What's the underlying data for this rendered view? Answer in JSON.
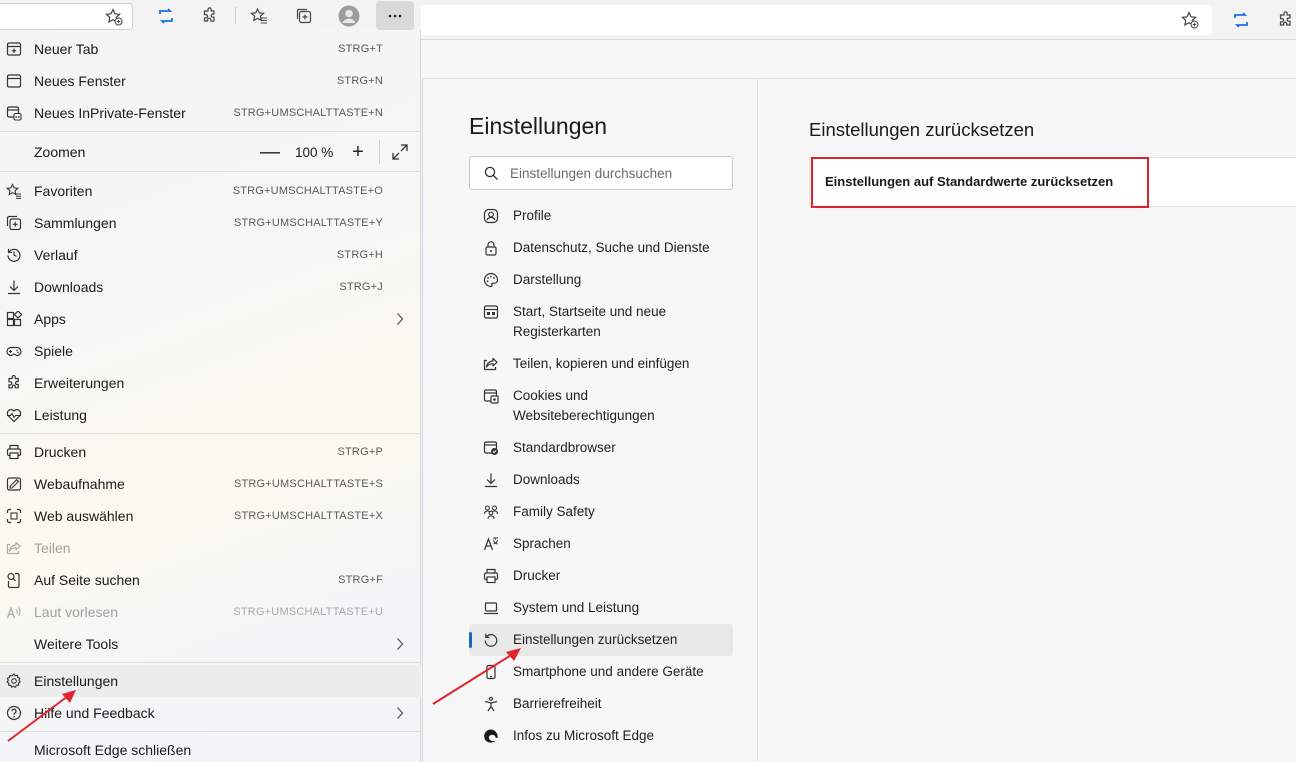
{
  "menu": {
    "items": [
      {
        "label": "Neuer Tab",
        "shortcut": "STRG+T",
        "icon": "new-tab-icon"
      },
      {
        "label": "Neues Fenster",
        "shortcut": "STRG+N",
        "icon": "new-window-icon"
      },
      {
        "label": "Neues InPrivate-Fenster",
        "shortcut": "STRG+UMSCHALTTASTE+N",
        "icon": "inprivate-icon"
      },
      {
        "label": "Zoomen",
        "icon": ""
      },
      {
        "label": "Favoriten",
        "shortcut": "STRG+UMSCHALTTASTE+O",
        "icon": "favorites-icon"
      },
      {
        "label": "Sammlungen",
        "shortcut": "STRG+UMSCHALTTASTE+Y",
        "icon": "collections-icon"
      },
      {
        "label": "Verlauf",
        "shortcut": "STRG+H",
        "icon": "history-icon"
      },
      {
        "label": "Downloads",
        "shortcut": "STRG+J",
        "icon": "download-icon"
      },
      {
        "label": "Apps",
        "icon": "apps-icon"
      },
      {
        "label": "Spiele",
        "icon": "games-icon"
      },
      {
        "label": "Erweiterungen",
        "icon": "extensions-icon"
      },
      {
        "label": "Leistung",
        "icon": "performance-icon"
      },
      {
        "label": "Drucken",
        "shortcut": "STRG+P",
        "icon": "print-icon"
      },
      {
        "label": "Webaufnahme",
        "shortcut": "STRG+UMSCHALTTASTE+S",
        "icon": "web-capture-icon"
      },
      {
        "label": "Web auswählen",
        "shortcut": "STRG+UMSCHALTTASTE+X",
        "icon": "web-select-icon"
      },
      {
        "label": "Teilen",
        "icon": "share-icon"
      },
      {
        "label": "Auf Seite suchen",
        "shortcut": "STRG+F",
        "icon": "find-icon"
      },
      {
        "label": "Laut vorlesen",
        "shortcut": "STRG+UMSCHALTTASTE+U",
        "icon": "read-aloud-icon"
      },
      {
        "label": "Weitere Tools",
        "icon": ""
      },
      {
        "label": "Einstellungen",
        "icon": "gear-icon"
      },
      {
        "label": "Hilfe und Feedback",
        "icon": "help-icon"
      },
      {
        "label": "Microsoft Edge schließen",
        "icon": ""
      }
    ],
    "zoom": {
      "minus": "—",
      "value": "100 %",
      "plus": "+"
    }
  },
  "settings": {
    "title": "Einstellungen",
    "search_placeholder": "Einstellungen durchsuchen",
    "nav": [
      {
        "label": "Profile",
        "icon": "profile-icon"
      },
      {
        "label": "Datenschutz, Suche und Dienste",
        "icon": "lock-icon"
      },
      {
        "label": "Darstellung",
        "icon": "palette-icon"
      },
      {
        "label": "Start, Startseite und neue Registerkarten",
        "icon": "start-page-icon"
      },
      {
        "label": "Teilen, kopieren und einfügen",
        "icon": "share-icon"
      },
      {
        "label": "Cookies und Websiteberechtigungen",
        "icon": "cookies-icon"
      },
      {
        "label": "Standardbrowser",
        "icon": "default-browser-icon"
      },
      {
        "label": "Downloads",
        "icon": "download-icon"
      },
      {
        "label": "Family Safety",
        "icon": "family-icon"
      },
      {
        "label": "Sprachen",
        "icon": "languages-icon"
      },
      {
        "label": "Drucker",
        "icon": "printer-icon"
      },
      {
        "label": "System und Leistung",
        "icon": "laptop-icon"
      },
      {
        "label": "Einstellungen zurücksetzen",
        "icon": "reset-icon"
      },
      {
        "label": "Smartphone und andere Geräte",
        "icon": "phone-icon"
      },
      {
        "label": "Barrierefreiheit",
        "icon": "accessibility-icon"
      },
      {
        "label": "Infos zu Microsoft Edge",
        "icon": "edge-icon"
      }
    ],
    "main_title": "Einstellungen zurücksetzen",
    "reset_option": "Einstellungen auf Standardwerte zurücksetzen"
  },
  "colors": {
    "accent": "#0f6cbd",
    "highlight": "#d9232d"
  }
}
